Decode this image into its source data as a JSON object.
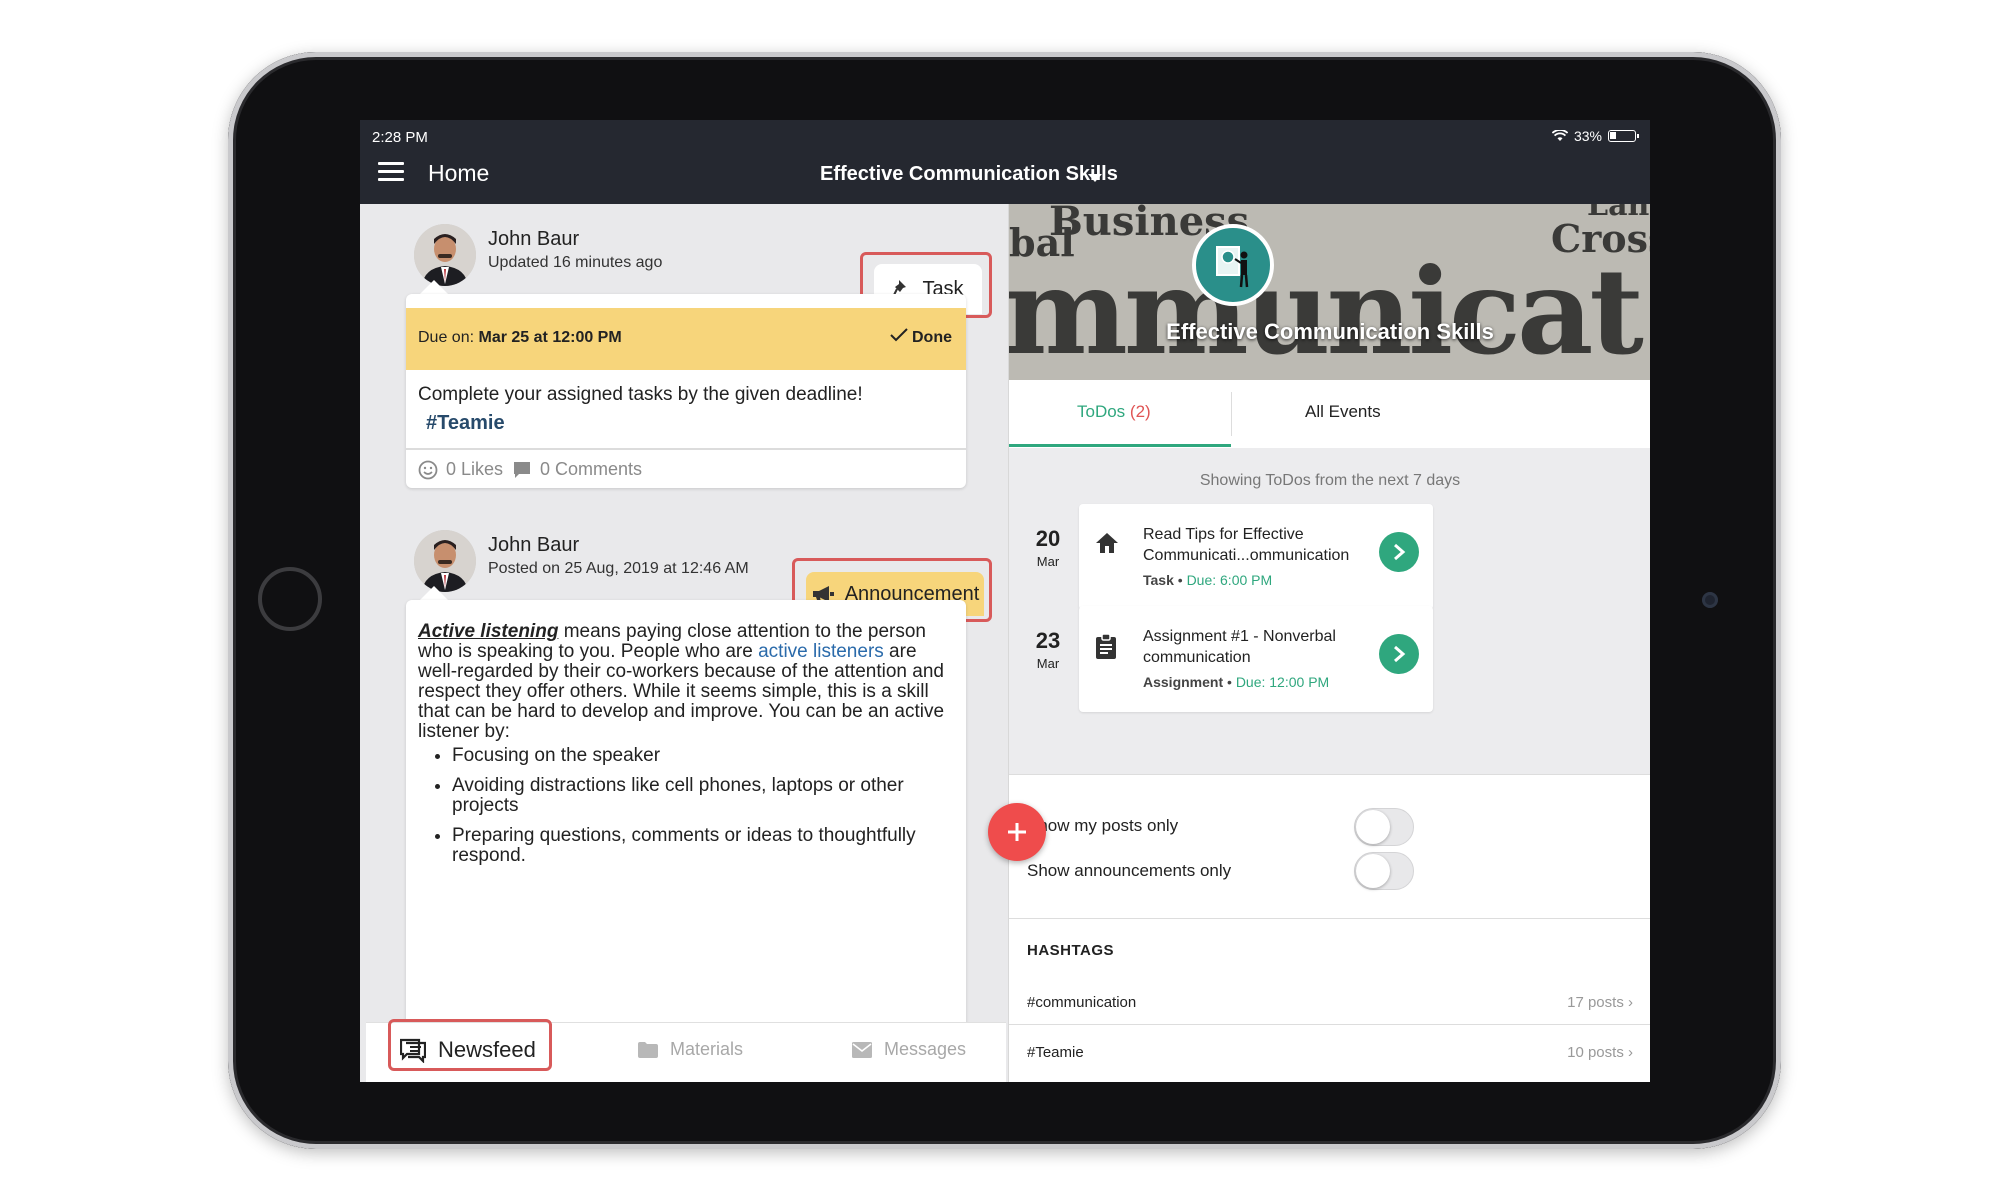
{
  "status_bar": {
    "time": "2:28 PM",
    "battery": "33%"
  },
  "header": {
    "home_label": "Home",
    "course_title": "Effective Communication Skills"
  },
  "posts": [
    {
      "author": "John Baur",
      "meta": "Updated 16 minutes ago",
      "tag": "Task",
      "due_label": "Due on:",
      "due_value": "Mar 25 at 12:00 PM",
      "done_label": "Done",
      "body": "Complete your assigned tasks by the given deadline!",
      "hashtag": "#Teamie",
      "likes": "0 Likes",
      "comments": "0 Comments"
    },
    {
      "author": "John Baur",
      "meta": "Posted on 25 Aug, 2019 at 12:46 AM",
      "tag": "Announcement",
      "body_lead": "Active listening",
      "body_part1": " means paying close attention to the person who is speaking to you. People who are ",
      "body_link": "active listeners",
      "body_part2": " are well-regarded by their co-workers because of the attention and respect they offer others. While it seems simple, this is a skill that can be hard to develop and improve. You can be an active listener by:",
      "bullets": [
        "Focusing on the speaker",
        "Avoiding distractions like cell phones, laptops or other projects",
        "Preparing questions, comments or ideas to thoughtfully respond."
      ]
    }
  ],
  "bottom_nav": {
    "newsfeed": "Newsfeed",
    "materials": "Materials",
    "messages": "Messages"
  },
  "sidebar": {
    "banner_words": [
      "Business",
      "bal",
      "Cross",
      "Langu",
      "mmunicat"
    ],
    "banner_title": "Effective Communication Skills",
    "tab_todos": "ToDos",
    "tab_todos_count": "(2)",
    "tab_events": "All Events",
    "todos_caption": "Showing ToDos from the next 7 days",
    "todos": [
      {
        "day": "20",
        "month": "Mar",
        "title": "Read Tips for Effective Communicati...ommunication",
        "type": "Task",
        "due": "Due: 6:00 PM",
        "icon": "home-icon"
      },
      {
        "day": "23",
        "month": "Mar",
        "title": "Assignment #1 - Nonverbal communication",
        "type": "Assignment",
        "due": "Due: 12:00 PM",
        "icon": "clipboard-icon"
      }
    ],
    "toggle_my_posts": "Show my posts only",
    "toggle_announcements": "Show announcements only",
    "hashtags_heading": "HASHTAGS",
    "hashtags": [
      {
        "tag": "#communication",
        "count": "17 posts"
      },
      {
        "tag": "#Teamie",
        "count": "10 posts"
      }
    ]
  },
  "colors": {
    "accent_green": "#2fa77e",
    "announcement_yellow": "#f7d57b",
    "fab_red": "#ef4c4c",
    "highlight_red": "#d85a5a",
    "topbar": "#252830"
  }
}
